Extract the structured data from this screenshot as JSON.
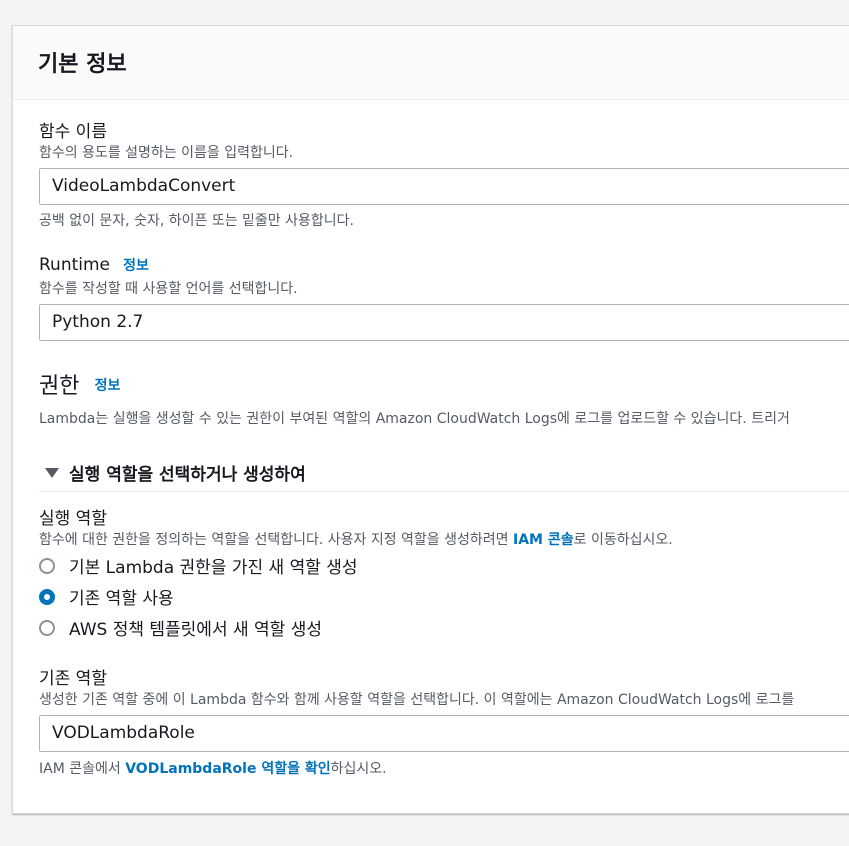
{
  "basic_info": {
    "title": "기본 정보"
  },
  "function_name": {
    "label": "함수 이름",
    "description": "함수의 용도를 설명하는 이름을 입력합니다.",
    "value": "VideoLambdaConvert",
    "hint": "공백 없이 문자, 숫자, 하이픈 또는 밑줄만 사용합니다."
  },
  "runtime": {
    "label": "Runtime",
    "info_link": "정보",
    "description": "함수를 작성할 때 사용할 언어를 선택합니다.",
    "value": "Python 2.7"
  },
  "permissions": {
    "title": "권한",
    "info_link": "정보",
    "description": "Lambda는 실행을 생성할 수 있는 권한이 부여된 역할의 Amazon CloudWatch Logs에 로그를 업로드할 수 있습니다. 트리거"
  },
  "execution_role_section": {
    "expander_label": "실행 역할을 선택하거나 생성하여",
    "label": "실행 역할",
    "description_prefix": "함수에 대한 권한을 정의하는 역할을 선택합니다. 사용자 지정 역할을 생성하려면 ",
    "description_link": "IAM 콘솔",
    "description_suffix": "로 이동하십시오.",
    "options": [
      {
        "label": "기본 Lambda 권한을 가진 새 역할 생성",
        "selected": false
      },
      {
        "label": "기존 역할 사용",
        "selected": true
      },
      {
        "label": "AWS 정책 템플릿에서 새 역할 생성",
        "selected": false
      }
    ]
  },
  "existing_role": {
    "label": "기존 역할",
    "description": "생성한 기존 역할 중에 이 Lambda 함수와 함께 사용할 역할을 선택합니다. 이 역할에는 Amazon CloudWatch Logs에 로그를",
    "value": "VODLambdaRole",
    "footer_prefix": "IAM 콘솔에서 ",
    "footer_link": "VODLambdaRole 역할을 확인",
    "footer_suffix": "하십시오."
  },
  "colors": {
    "accent": "#0073bb",
    "text": "#16191f",
    "secondary_text": "#545b64",
    "background": "#f2f3f3"
  }
}
